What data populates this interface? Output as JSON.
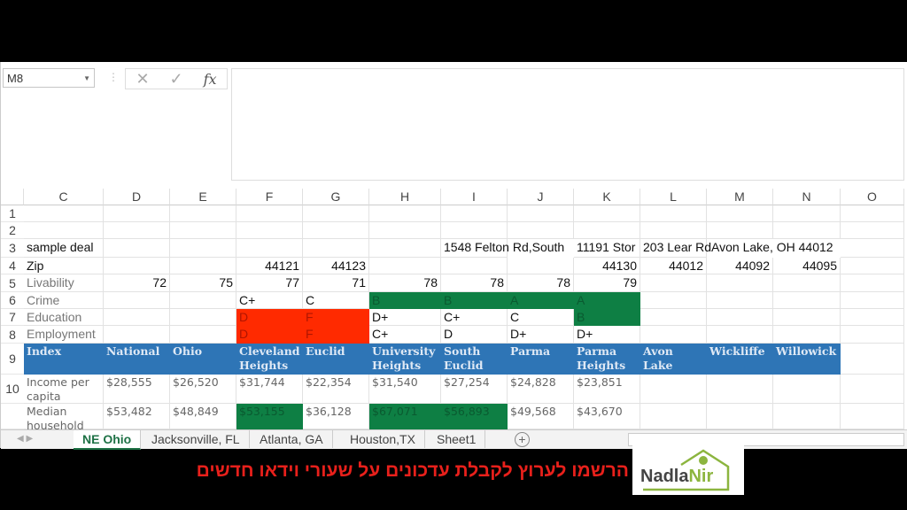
{
  "formula_bar": {
    "name_box": "M8",
    "cancel": "✕",
    "enter": "✓",
    "fx": "fx",
    "content": ""
  },
  "colors": {
    "green": "#0e7f44",
    "red": "#ff2a00",
    "blue": "#2e75b6"
  },
  "sheet": {
    "columns": [
      "C",
      "D",
      "E",
      "F",
      "G",
      "H",
      "I",
      "J",
      "K",
      "L",
      "M",
      "N",
      "O"
    ],
    "rows": [
      {
        "num": "1",
        "cells": []
      },
      {
        "num": "2",
        "cells": []
      },
      {
        "num": "3",
        "cells": [
          {
            "c": 0,
            "v": "sample deal"
          },
          {
            "c": 6,
            "v": "1548 Felton Rd,South"
          },
          {
            "c": 8,
            "v": "11191 Stor"
          },
          {
            "c": 9,
            "v": "203 Lear RdAvon Lake, OH 44012"
          }
        ]
      },
      {
        "num": "4",
        "cells": [
          {
            "c": 0,
            "v": "Zip"
          },
          {
            "c": 3,
            "v": "44121",
            "r": 1
          },
          {
            "c": 4,
            "v": "44123",
            "r": 1
          },
          {
            "c": 8,
            "v": "44130",
            "r": 1
          },
          {
            "c": 9,
            "v": "44012",
            "r": 1
          },
          {
            "c": 10,
            "v": "44092",
            "r": 1
          },
          {
            "c": 11,
            "v": "44095",
            "r": 1
          }
        ]
      },
      {
        "num": "5",
        "cells": [
          {
            "c": 0,
            "v": "Livability",
            "g": 1
          },
          {
            "c": 1,
            "v": "72",
            "r": 1
          },
          {
            "c": 2,
            "v": "75",
            "r": 1
          },
          {
            "c": 3,
            "v": "77",
            "r": 1
          },
          {
            "c": 4,
            "v": "71",
            "r": 1
          },
          {
            "c": 5,
            "v": "78",
            "r": 1
          },
          {
            "c": 6,
            "v": "78",
            "r": 1
          },
          {
            "c": 7,
            "v": "78",
            "r": 1
          },
          {
            "c": 8,
            "v": "79",
            "r": 1
          }
        ]
      },
      {
        "num": "6",
        "cells": [
          {
            "c": 0,
            "v": "Crime",
            "g": 1
          },
          {
            "c": 3,
            "v": "C+"
          },
          {
            "c": 4,
            "v": "C"
          },
          {
            "c": 5,
            "v": "B",
            "fill": "green"
          },
          {
            "c": 6,
            "v": "B",
            "fill": "green"
          },
          {
            "c": 7,
            "v": "A",
            "fill": "green"
          },
          {
            "c": 8,
            "v": "A",
            "fill": "green"
          }
        ]
      },
      {
        "num": "7",
        "cells": [
          {
            "c": 0,
            "v": "Education",
            "g": 1
          },
          {
            "c": 3,
            "v": "D",
            "fill": "red"
          },
          {
            "c": 4,
            "v": "F",
            "fill": "red"
          },
          {
            "c": 5,
            "v": "D+"
          },
          {
            "c": 6,
            "v": "C+"
          },
          {
            "c": 7,
            "v": "C"
          },
          {
            "c": 8,
            "v": "B",
            "fill": "green"
          }
        ]
      },
      {
        "num": "8",
        "cells": [
          {
            "c": 0,
            "v": "Employment",
            "g": 1
          },
          {
            "c": 3,
            "v": "D",
            "fill": "red"
          },
          {
            "c": 4,
            "v": "F",
            "fill": "red"
          },
          {
            "c": 5,
            "v": "C+"
          },
          {
            "c": 6,
            "v": "D"
          },
          {
            "c": 7,
            "v": "D+"
          },
          {
            "c": 8,
            "v": "D+"
          }
        ]
      },
      {
        "num": "9",
        "cells": [
          {
            "c": 0,
            "v": "Index",
            "h": 1
          },
          {
            "c": 1,
            "v": "National",
            "h": 1
          },
          {
            "c": 2,
            "v": "Ohio",
            "h": 1
          },
          {
            "c": 3,
            "v": "Cleveland Heights",
            "h": 1
          },
          {
            "c": 4,
            "v": "Euclid",
            "h": 1
          },
          {
            "c": 5,
            "v": "University Heights",
            "h": 1
          },
          {
            "c": 6,
            "v": "South Euclid",
            "h": 1
          },
          {
            "c": 7,
            "v": "Parma",
            "h": 1
          },
          {
            "c": 8,
            "v": "Parma Heights",
            "h": 1
          },
          {
            "c": 9,
            "v": "Avon Lake",
            "h": 1
          },
          {
            "c": 10,
            "v": "Wickliffe",
            "h": 1
          },
          {
            "c": 11,
            "v": "Willowick",
            "h": 1
          }
        ]
      },
      {
        "num": "10",
        "cells": [
          {
            "c": 0,
            "v": "Income per capita",
            "vd": 1
          },
          {
            "c": 1,
            "v": "$28,555",
            "vd": 1
          },
          {
            "c": 2,
            "v": "$26,520",
            "vd": 1
          },
          {
            "c": 3,
            "v": "$31,744",
            "vd": 1
          },
          {
            "c": 4,
            "v": "$22,354",
            "vd": 1
          },
          {
            "c": 5,
            "v": "$31,540",
            "vd": 1
          },
          {
            "c": 6,
            "v": "$27,254",
            "vd": 1
          },
          {
            "c": 7,
            "v": "$24,828",
            "vd": 1
          },
          {
            "c": 8,
            "v": "$23,851",
            "vd": 1
          }
        ]
      },
      {
        "num": "",
        "cells": [
          {
            "c": 0,
            "v": "Median household",
            "vd": 1
          },
          {
            "c": 1,
            "v": "$53,482",
            "vd": 1
          },
          {
            "c": 2,
            "v": "$48,849",
            "vd": 1
          },
          {
            "c": 3,
            "v": "$53,155",
            "vd": 1,
            "fill": "green"
          },
          {
            "c": 4,
            "v": "$36,128",
            "vd": 1
          },
          {
            "c": 5,
            "v": "$67,071",
            "vd": 1,
            "fill": "green"
          },
          {
            "c": 6,
            "v": "$56,893",
            "vd": 1,
            "fill": "green"
          },
          {
            "c": 7,
            "v": "$49,568",
            "vd": 1
          },
          {
            "c": 8,
            "v": "$43,670",
            "vd": 1
          }
        ]
      }
    ]
  },
  "tabs": [
    {
      "label": "NE Ohio",
      "active": true
    },
    {
      "label": "Jacksonville, FL"
    },
    {
      "label": "Atlanta, GA"
    },
    {
      "label": "Houston,TX"
    },
    {
      "label": "Sheet1"
    }
  ],
  "add_sheet": "+",
  "banner": {
    "text": "הרשמו לערוץ לקבלת עדכונים על שעורי וידאו חדשים",
    "logo_a": "Nadla",
    "logo_b": "Nir"
  }
}
